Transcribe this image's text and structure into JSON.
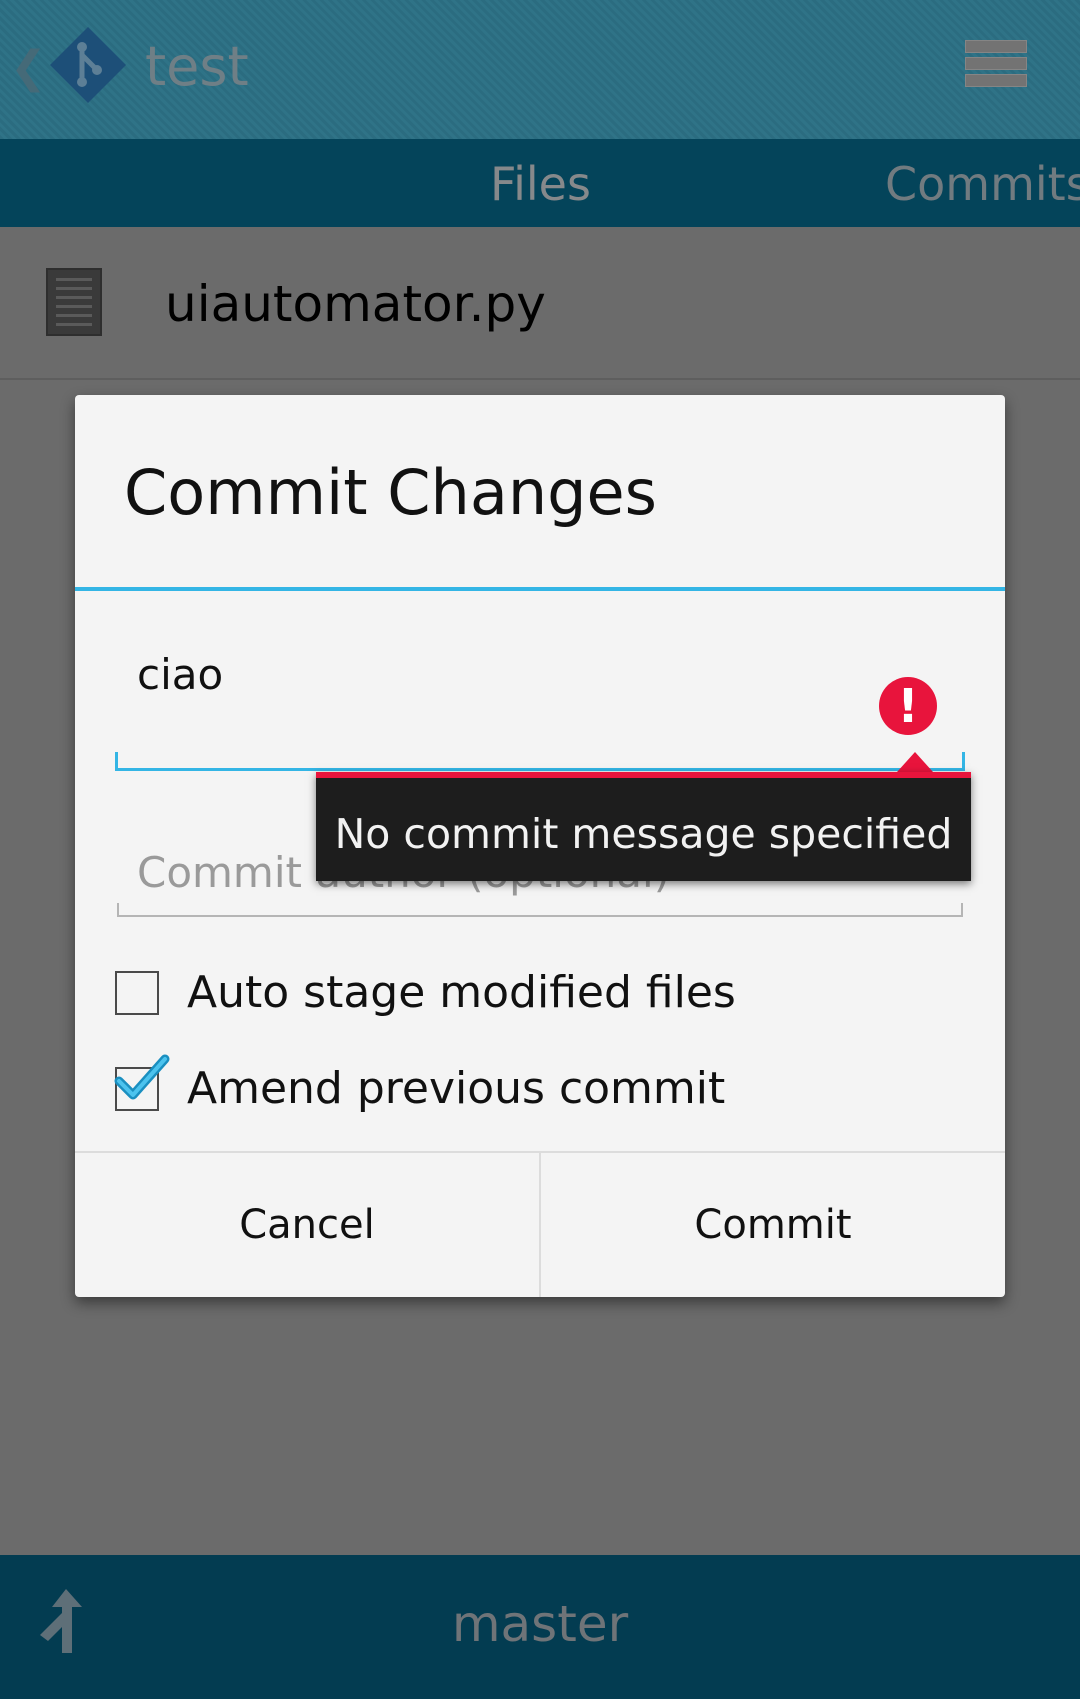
{
  "action_bar": {
    "title": "test",
    "up_icon": "chevron-left-icon",
    "logo_icon": "git-logo-icon",
    "menu_icon": "storage-menu-icon"
  },
  "tabs": [
    {
      "label": "Files",
      "selected": true
    },
    {
      "label": "Commits",
      "selected": false
    }
  ],
  "files": [
    {
      "name": "uiautomator.py",
      "icon": "document-icon"
    }
  ],
  "dialog": {
    "title": "Commit Changes",
    "message_value": "ciao",
    "error_icon": "error-exclamation-icon",
    "error_text": "No commit message specified",
    "author_placeholder": "Commit author (optional)",
    "author_value": "",
    "checkboxes": [
      {
        "label": "Auto stage modified files",
        "checked": false
      },
      {
        "label": "Amend previous commit",
        "checked": true
      }
    ],
    "cancel_label": "Cancel",
    "commit_label": "Commit"
  },
  "bottom_bar": {
    "branch_name": "master",
    "branch_icon": "branch-merge-icon"
  },
  "colors": {
    "accent": "#33b5e5",
    "error": "#e8143c",
    "tab_bar": "#04445a",
    "bottom_bar": "#033c51"
  }
}
